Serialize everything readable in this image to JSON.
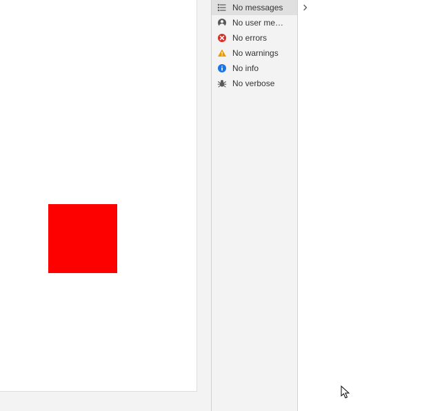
{
  "preview": {
    "square_color": "#fd0101"
  },
  "console": {
    "filters": [
      {
        "id": "messages",
        "label": "No messages",
        "selected": true
      },
      {
        "id": "user",
        "label": "No user me…",
        "selected": false
      },
      {
        "id": "errors",
        "label": "No errors",
        "selected": false
      },
      {
        "id": "warnings",
        "label": "No warnings",
        "selected": false
      },
      {
        "id": "info",
        "label": "No info",
        "selected": false
      },
      {
        "id": "verbose",
        "label": "No verbose",
        "selected": false
      }
    ]
  }
}
